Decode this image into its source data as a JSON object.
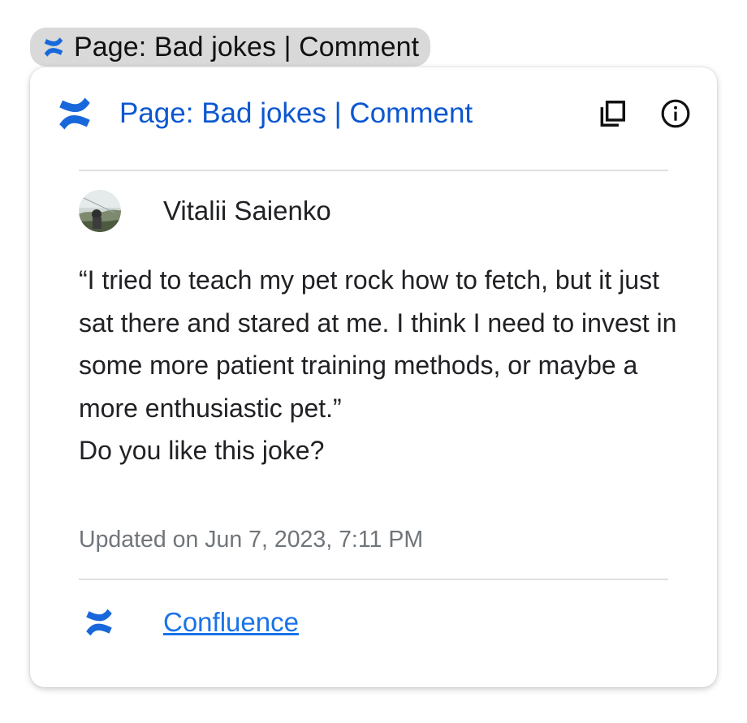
{
  "chip": {
    "label": "Page: Bad jokes | Comment",
    "icon": "confluence-logo-icon"
  },
  "card": {
    "title": "Page: Bad jokes | Comment",
    "actions": [
      {
        "icon": "copy-icon"
      },
      {
        "icon": "info-icon"
      }
    ],
    "author": {
      "name": "Vitalii Saienko",
      "avatar": "avatar-photo"
    },
    "comment": {
      "quote": "“I tried to teach my pet rock how to fetch, but it just sat there and stared at me. I think I need to invest in some more patient training methods, or maybe a more enthusiastic pet.”",
      "question": "Do you like this joke?"
    },
    "updated": "Updated on Jun 7, 2023, 7:11 PM",
    "footer": {
      "source_label": "Confluence",
      "icon": "confluence-logo-icon"
    }
  },
  "colors": {
    "brand_blue": "#1868DB",
    "title_blue": "#0b57d0",
    "link_blue": "#1a73e8",
    "chip_bg": "#d9d9d9",
    "muted_text": "#70757a"
  }
}
